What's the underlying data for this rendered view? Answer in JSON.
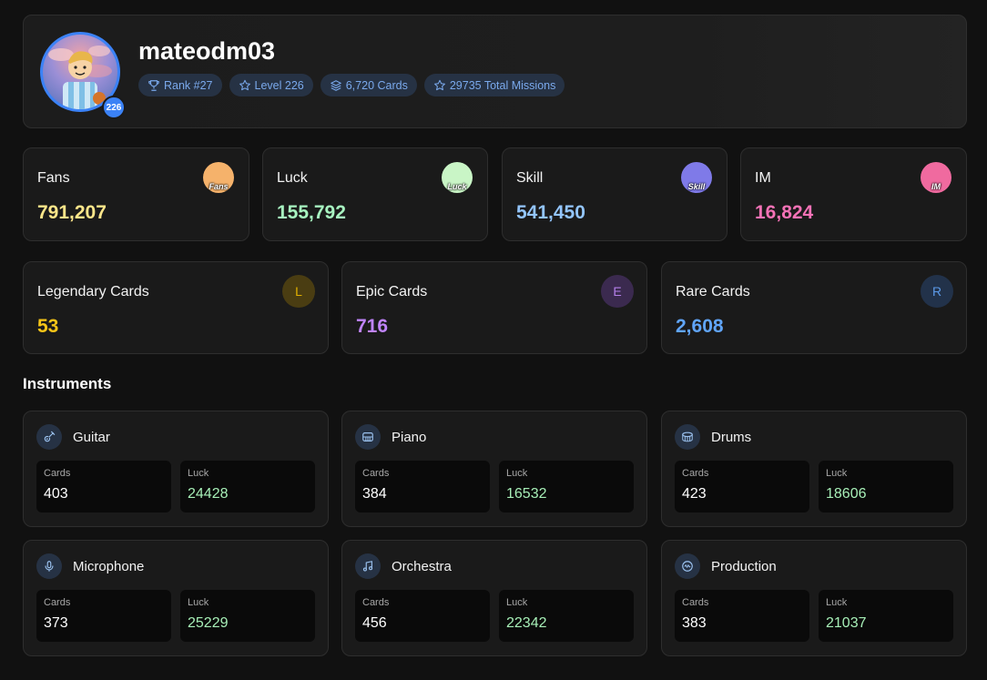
{
  "profile": {
    "username": "mateodm03",
    "avatar_badge": "226",
    "pills": [
      {
        "icon": "trophy-icon",
        "label": "Rank #27"
      },
      {
        "icon": "star-icon",
        "label": "Level 226"
      },
      {
        "icon": "layers-icon",
        "label": "6,720 Cards"
      },
      {
        "icon": "star-icon",
        "label": "29735 Total Missions"
      }
    ]
  },
  "stats": [
    {
      "label": "Fans",
      "value": "791,207",
      "color": "#fde68a",
      "icon_text": "Fans",
      "icon_bg": "#f5b26b"
    },
    {
      "label": "Luck",
      "value": "155,792",
      "color": "#a7f3c0",
      "icon_text": "Luck",
      "icon_bg": "#c9f5c6"
    },
    {
      "label": "Skill",
      "value": "541,450",
      "color": "#93c5fd",
      "icon_text": "Skill",
      "icon_bg": "#7f7ae8"
    },
    {
      "label": "IM",
      "value": "16,824",
      "color": "#f472b6",
      "icon_text": "IM",
      "icon_bg": "#f06a9f"
    }
  ],
  "rarities": [
    {
      "label": "Legendary Cards",
      "value": "53",
      "letter": "L",
      "color": "#f5c518",
      "icon_bg": "#4a3d12",
      "icon_color": "#e0b000"
    },
    {
      "label": "Epic Cards",
      "value": "716",
      "letter": "E",
      "color": "#c084fc",
      "icon_bg": "#3b2a4f",
      "icon_color": "#b37fe8"
    },
    {
      "label": "Rare Cards",
      "value": "2,608",
      "letter": "R",
      "color": "#60a5fa",
      "icon_bg": "#22324a",
      "icon_color": "#5c9ae8"
    }
  ],
  "instruments_title": "Instruments",
  "instruments": [
    {
      "name": "Guitar",
      "icon": "guitar-icon",
      "cards_label": "Cards",
      "cards": "403",
      "luck_label": "Luck",
      "luck": "24428"
    },
    {
      "name": "Piano",
      "icon": "piano-icon",
      "cards_label": "Cards",
      "cards": "384",
      "luck_label": "Luck",
      "luck": "16532"
    },
    {
      "name": "Drums",
      "icon": "drum-icon",
      "cards_label": "Cards",
      "cards": "423",
      "luck_label": "Luck",
      "luck": "18606"
    },
    {
      "name": "Microphone",
      "icon": "microphone-icon",
      "cards_label": "Cards",
      "cards": "373",
      "luck_label": "Luck",
      "luck": "25229"
    },
    {
      "name": "Orchestra",
      "icon": "music-note-icon",
      "cards_label": "Cards",
      "cards": "456",
      "luck_label": "Luck",
      "luck": "22342"
    },
    {
      "name": "Production",
      "icon": "waveform-icon",
      "cards_label": "Cards",
      "cards": "383",
      "luck_label": "Luck",
      "luck": "21037"
    }
  ]
}
